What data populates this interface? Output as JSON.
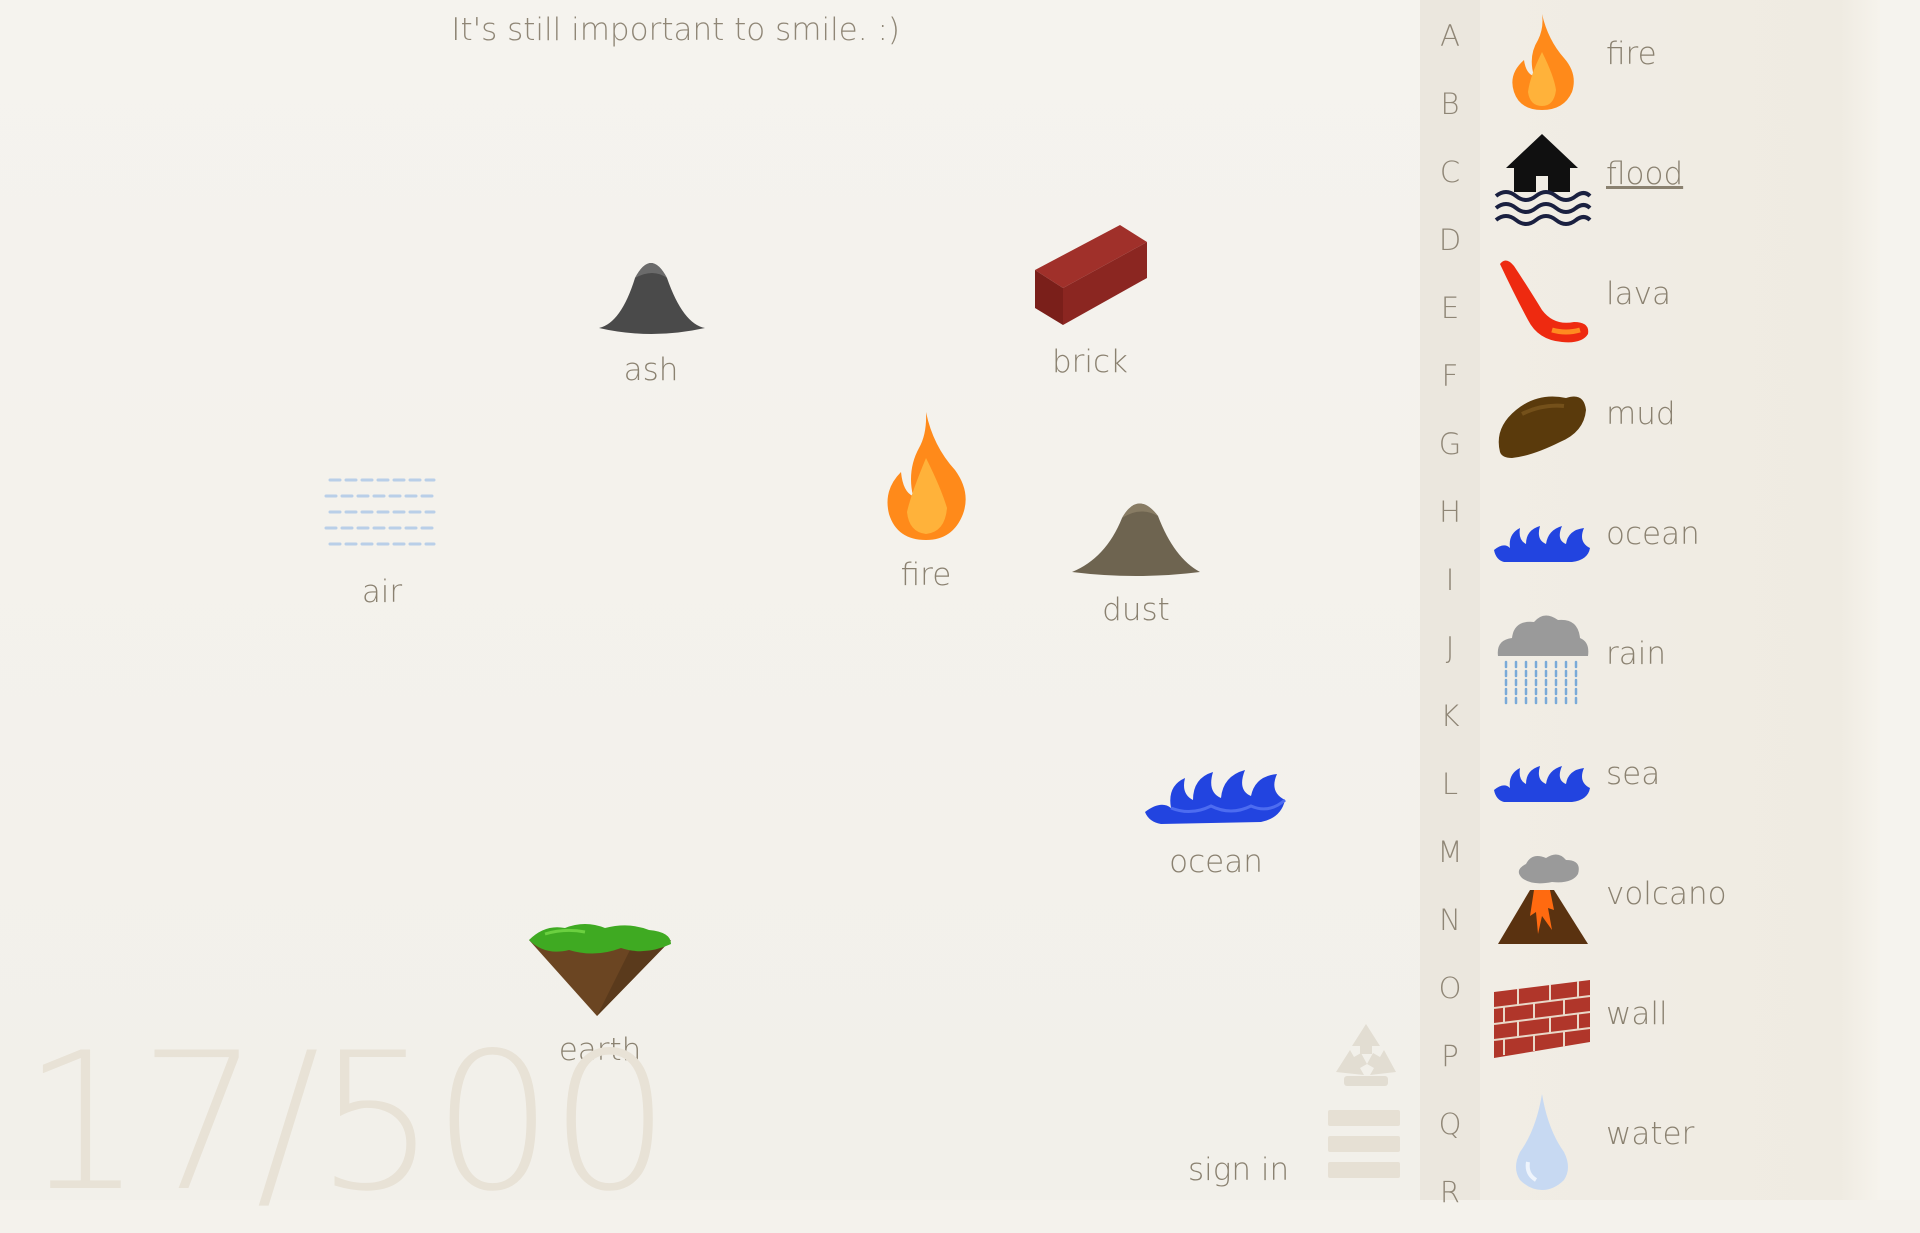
{
  "tip": "It's still important to smile. :)",
  "counter": "17/500",
  "sign_in": "sign in",
  "workspace": {
    "ash": "ash",
    "brick": "brick",
    "fire": "fire",
    "air": "air",
    "dust": "dust",
    "ocean": "ocean",
    "earth": "earth"
  },
  "alphabet": [
    "A",
    "B",
    "C",
    "D",
    "E",
    "F",
    "G",
    "H",
    "I",
    "J",
    "K",
    "L",
    "M",
    "N",
    "O",
    "P",
    "Q",
    "R"
  ],
  "list": {
    "fire": "fire",
    "flood": "flood",
    "lava": "lava",
    "mud": "mud",
    "ocean": "ocean",
    "rain": "rain",
    "sea": "sea",
    "volcano": "volcano",
    "wall": "wall",
    "water": "water"
  }
}
